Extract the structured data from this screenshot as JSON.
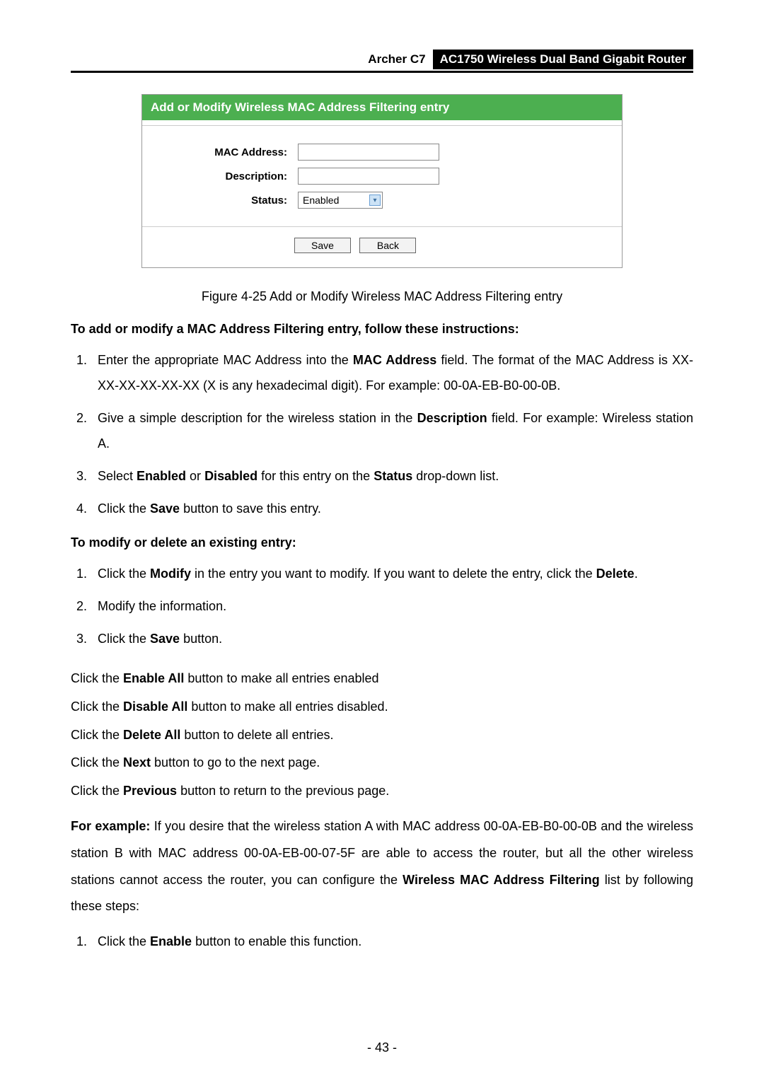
{
  "header": {
    "model": "Archer C7",
    "product": "AC1750 Wireless Dual Band Gigabit Router"
  },
  "screenshot": {
    "title": "Add or Modify Wireless MAC Address Filtering entry",
    "labels": {
      "mac": "MAC Address:",
      "description": "Description:",
      "status": "Status:"
    },
    "status_value": "Enabled",
    "buttons": {
      "save": "Save",
      "back": "Back"
    }
  },
  "figure_caption": "Figure 4-25 Add or Modify Wireless MAC Address Filtering entry",
  "heading_add": "To add or modify a MAC Address Filtering entry, follow these instructions:",
  "instructions_add": [
    "Enter the appropriate MAC Address into the <b>MAC Address</b> field. The format of the MAC Address is XX-XX-XX-XX-XX-XX (X is any hexadecimal digit). For example: 00-0A-EB-B0-00-0B.",
    "Give a simple description for the wireless station in the <b>Description</b> field. For example: Wireless station A.",
    "Select <b>Enabled</b> or <b>Disabled</b> for this entry on the <b>Status</b> drop-down list.",
    "Click the <b>Save</b> button to save this entry."
  ],
  "heading_modify": "To modify or delete an existing entry:",
  "instructions_modify": [
    "Click the <b>Modify</b> in the entry you want to modify. If you want to delete the entry, click the <b>Delete</b>.",
    "Modify the information.",
    "Click the <b>Save</b> button."
  ],
  "paras": [
    "Click the <b>Enable All</b> button to make all entries enabled",
    "Click the <b>Disable All</b> button to make all entries disabled.",
    "Click the <b>Delete All</b> button to delete all entries.",
    "Click the <b>Next</b> button to go to the next page.",
    "Click the <b>Previous</b> button to return to the previous page."
  ],
  "example_para": "<b>For example:</b> If you desire that the wireless station A with MAC address 00-0A-EB-B0-00-0B and the wireless station B with MAC address 00-0A-EB-00-07-5F are able to access the router, but all the other wireless stations cannot access the router, you can configure the <b>Wireless MAC Address Filtering</b> list by following these steps:",
  "example_steps": [
    "Click the <b>Enable</b> button to enable this function."
  ],
  "page_number": "- 43 -"
}
